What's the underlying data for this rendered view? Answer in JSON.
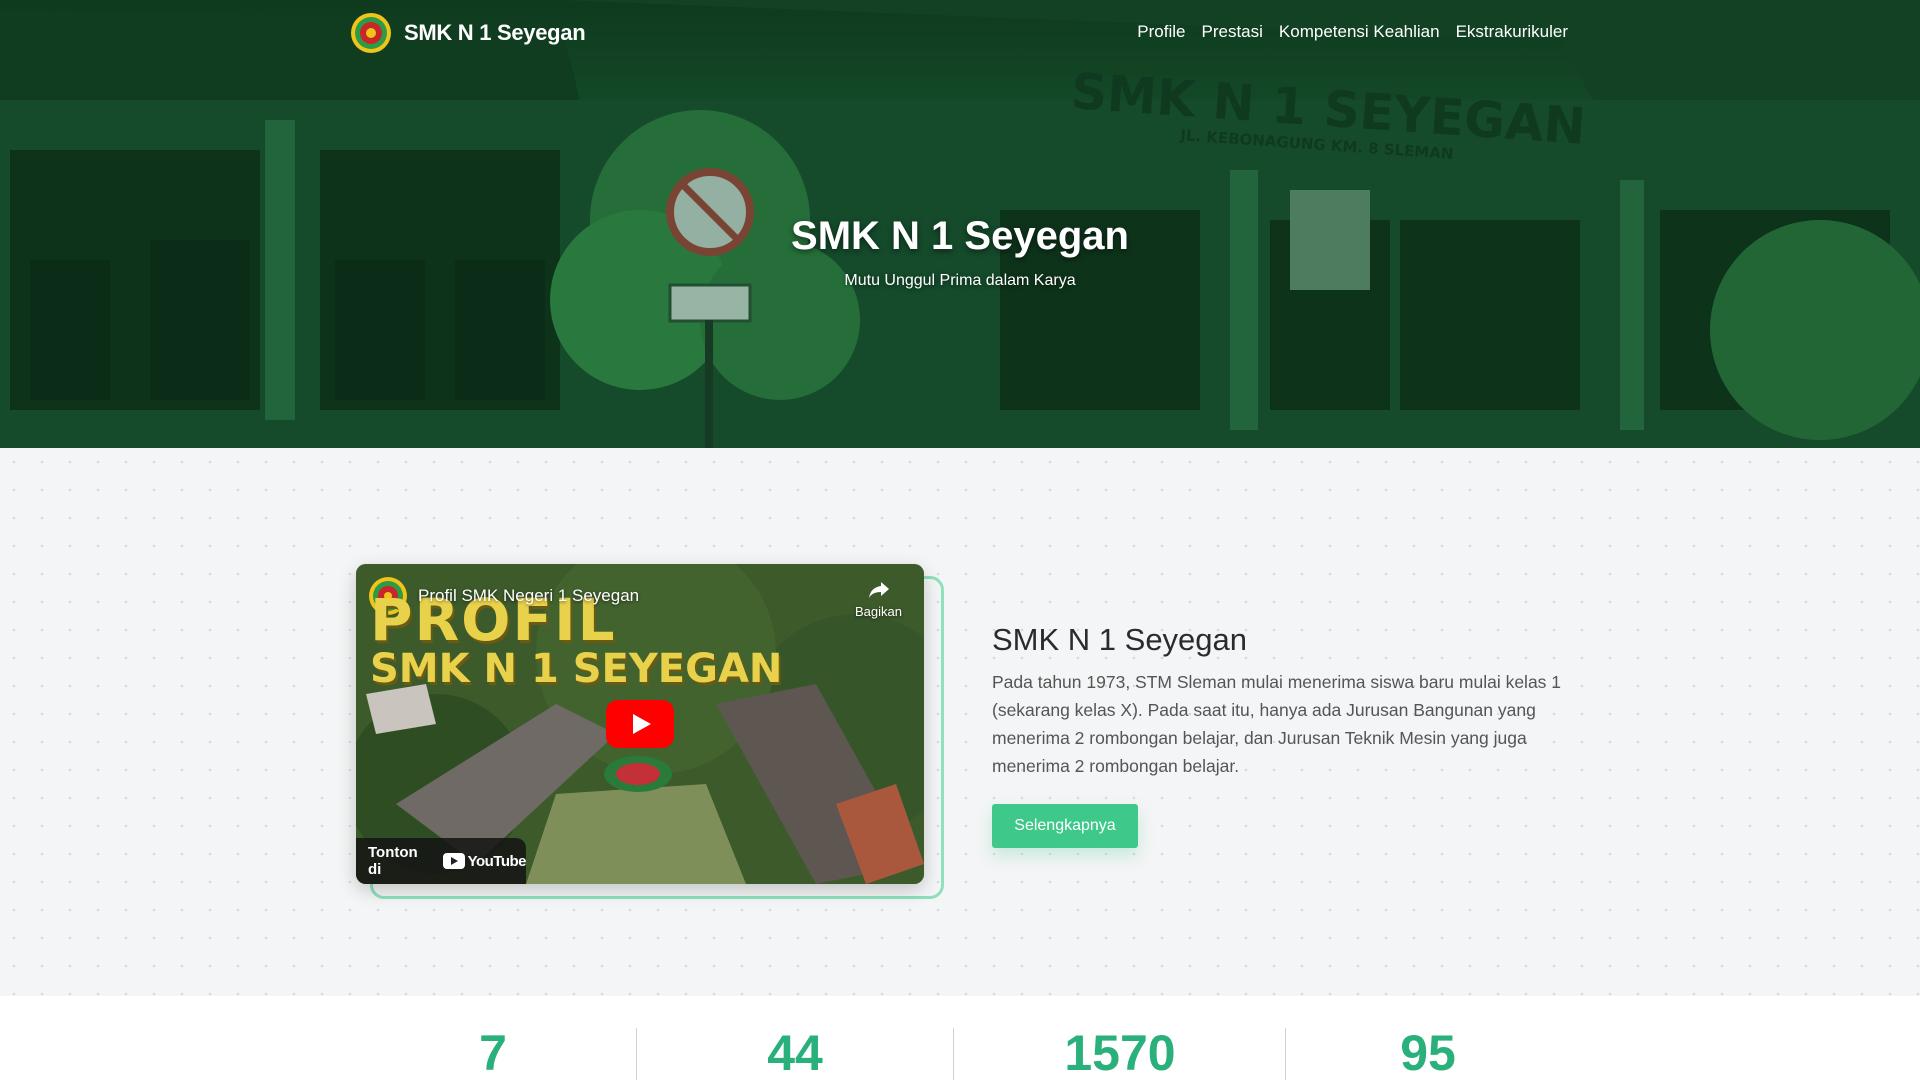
{
  "nav": {
    "brand": "SMK N 1 Seyegan",
    "links": [
      "Profile",
      "Prestasi",
      "Kompetensi Keahlian",
      "Ekstrakurikuler"
    ]
  },
  "hero": {
    "title": "SMK N 1 Seyegan",
    "subtitle": "Mutu Unggul Prima dalam Karya",
    "sign_text": "SMK N 1 SEYEGAN",
    "sign_subtext": "JL. KEBONAGUNG KM. 8 SLEMAN"
  },
  "video": {
    "title": "Profil SMK Negeri 1 Seyegan",
    "share_label": "Bagikan",
    "overlay_line1": "PROFIL",
    "overlay_line2": "SMK N 1 SEYEGAN",
    "watch_label": "Tonton di",
    "platform": "YouTube"
  },
  "about": {
    "title": "SMK N 1 Seyegan",
    "body": "Pada tahun 1973, STM Sleman mulai menerima siswa baru mulai kelas 1 (sekarang kelas X). Pada saat itu, hanya ada Jurusan Bangunan yang menerima 2 rombongan belajar, dan Jurusan Teknik Mesin yang juga menerima 2 rombongan belajar.",
    "button": "Selengkapnya"
  },
  "stats": [
    "7",
    "44",
    "1570",
    "95"
  ],
  "colors": {
    "accent": "#3ec98a",
    "stat_text": "#2ab07a",
    "hero_tint": "#1c5a33",
    "frame": "#8fe0bb",
    "play": "#ff0000"
  }
}
